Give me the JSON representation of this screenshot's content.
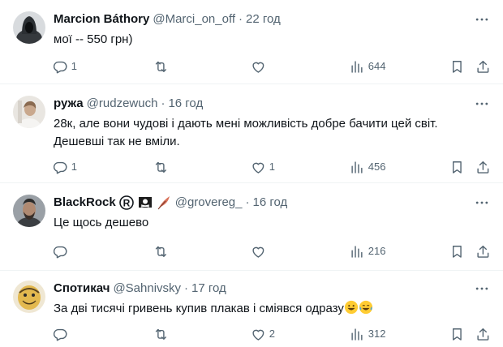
{
  "tweets": [
    {
      "name": "Marcion Báthory",
      "handle": "@Marci_on_off",
      "separator": "·",
      "time": "22 год",
      "text": "мої -- 550 грн)",
      "replies": "1",
      "retweets": "",
      "likes": "",
      "views": "644",
      "avatar_icon": "hooded-figure-avatar"
    },
    {
      "name": "ружа",
      "handle": "@rudzewuch",
      "separator": "·",
      "time": "16 год",
      "text": "28к, але вони чудові і дають мені можливість добре бачити цей світ. Дешевші так не вміли.",
      "replies": "1",
      "retweets": "",
      "likes": "1",
      "views": "456",
      "avatar_icon": "person-photo-avatar"
    },
    {
      "name": "BlackRock",
      "handle": "@grovereg_",
      "separator": "·",
      "time": "16 год",
      "text": "Це щось дешево",
      "replies": "",
      "retweets": "",
      "likes": "",
      "views": "216",
      "avatar_icon": "bearded-man-avatar",
      "name_badges": [
        "registered-icon",
        "pirate-flag-icon",
        "feather-icon"
      ]
    },
    {
      "name": "Спотикач",
      "handle": "@Sahnivsky",
      "separator": "·",
      "time": "17 год",
      "text": "За дві тисячі гривень купив плакав і сміявся одразу",
      "text_emojis": [
        "grinning-face-icon",
        "tears-of-joy-icon"
      ],
      "replies": "",
      "retweets": "",
      "likes": "2",
      "views": "312",
      "avatar_icon": "cartoon-face-avatar"
    }
  ],
  "colors": {
    "text_primary": "#0f1419",
    "text_secondary": "#536471",
    "divider": "#eff3f4"
  }
}
